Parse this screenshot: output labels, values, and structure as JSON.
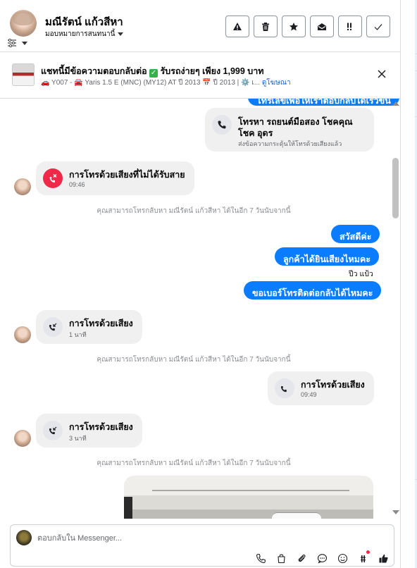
{
  "header": {
    "contact_name": "มณีรัตน์ แก้วสีหา",
    "assign_label": "มอบหมายการสนทนานี้",
    "actions": [
      {
        "icon": "warning-icon",
        "name": "spam-button"
      },
      {
        "icon": "trash-icon",
        "name": "delete-button"
      },
      {
        "icon": "star-icon",
        "name": "star-button"
      },
      {
        "icon": "envelope-open-icon",
        "name": "mark-read-button"
      },
      {
        "icon": "follow-up-icon",
        "name": "follow-up-button"
      },
      {
        "icon": "check-icon",
        "name": "done-button"
      }
    ]
  },
  "banner": {
    "title": "แชทนี้มีข้อความตอบกลับต่อ",
    "title_tail": "รับรถง่ายๆ เพียง 1,999 บาท",
    "subtitle": "🚗 Y007 - 🚘 Yaris 1.5 E (MNC) (MY12) AT ปี 2013 📅 ปี 2013 | ⚙️ เ...",
    "link_label": "ดูโฆษณา"
  },
  "messages": {
    "top_cut_bubble": "โทรเลขเพื่อให้เราตอบกลับได้เร็วขึ้น",
    "outgoing_call_card": {
      "title_line1": "โทรหา รถยนต์มือสอง โชคคุณ",
      "title_line2": "โชค อุดร",
      "note": "ส่งข้อความกระตุ้นให้โทรด้วยเสียงแล้ว"
    },
    "missed_call": {
      "title": "การโทรด้วยเสียงที่ไม่ได้รับสาย",
      "time": "09:46"
    },
    "callback_note_1": "คุณสามารถโทรกลับหา มณีรัตน์ แก้วสีหา ได้ในอีก 7 วันนับจากนี้",
    "out_1": "สวัสดีค่ะ",
    "out_2": "ลูกค้าได้ยินเสียงไหมคะ",
    "sender_label": "ปีว แป้ว",
    "out_3": "ขอเบอร์โทรติดต่อกลับได้ไหมคะ",
    "in_call_1": {
      "title": "การโทรด้วยเสียง",
      "time": "1 นาที"
    },
    "callback_note_2": "คุณสามารถโทรกลับหา มณีรัตน์ แก้วสีหา ได้ในอีก 7 วันนับจากนี้",
    "out_call": {
      "title": "การโทรด้วยเสียง",
      "time": "09:49"
    },
    "in_call_2": {
      "title": "การโทรด้วยเสียง",
      "time": "3 นาที"
    },
    "callback_note_3": "คุณสามารถโทรกลับหา มณีรัตน์ แก้วสีหา ได้ในอีก 7 วันนับจากนี้"
  },
  "composer": {
    "placeholder": "ตอบกลับใน Messenger...",
    "tools": [
      "phone-icon",
      "bag-icon",
      "paperclip-icon",
      "chat-bubble-icon",
      "emoji-icon",
      "quick-reply-icon",
      "thumbs-up-icon"
    ]
  },
  "colors": {
    "outgoing": "#0a7cff",
    "incoming": "#f0f0f0",
    "missed": "#f02849"
  }
}
